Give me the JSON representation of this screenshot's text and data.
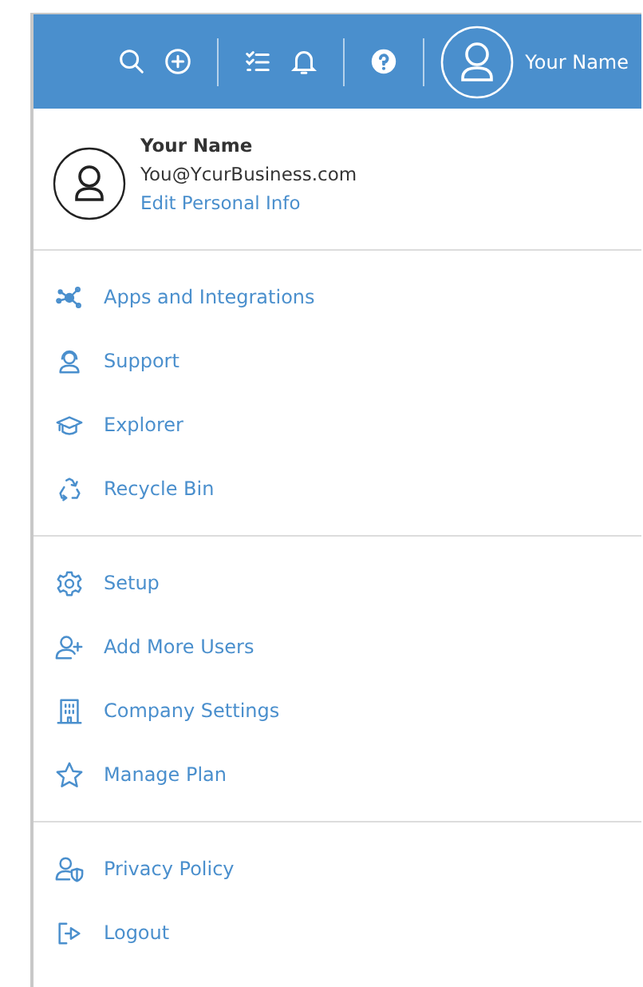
{
  "top_bar": {
    "groups": [
      [
        {
          "kind": "search"
        },
        {
          "kind": "add"
        }
      ],
      [
        {
          "kind": "tasks"
        },
        {
          "kind": "bell"
        }
      ],
      [
        {
          "kind": "help"
        }
      ]
    ],
    "user_name": "Your Name"
  },
  "profile": {
    "name": "Your Name",
    "email": "You@YcurBusiness.com",
    "link": "Edit Personal Info"
  },
  "sections": [
    [
      {
        "kind": "apps",
        "label": "Apps and Integrations"
      },
      {
        "kind": "support",
        "label": "Support"
      },
      {
        "kind": "explorer",
        "label": "Explorer"
      },
      {
        "kind": "recycle",
        "label": "Recycle Bin"
      }
    ],
    [
      {
        "kind": "setup",
        "label": "Setup"
      },
      {
        "kind": "users",
        "label": "Add More Users"
      },
      {
        "kind": "company",
        "label": "Company Settings"
      },
      {
        "kind": "plan",
        "label": "Manage Plan"
      }
    ],
    [
      {
        "kind": "privacy",
        "label": "Privacy Policy"
      },
      {
        "kind": "logout",
        "label": "Logout"
      }
    ]
  ]
}
